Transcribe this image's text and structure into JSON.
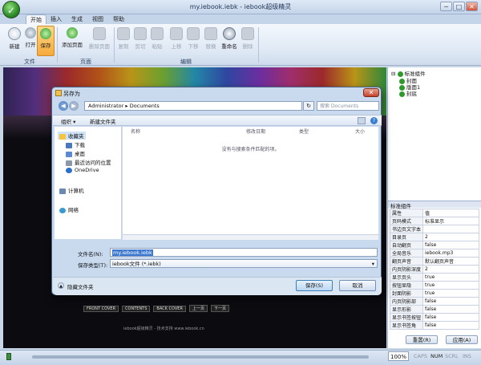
{
  "window": {
    "title": "my.iebook.iebk - iebook超级精灵",
    "logo_glyph": "✓",
    "min": "─",
    "max": "□",
    "close": "✕"
  },
  "tabs": [
    "开始",
    "插入",
    "生成",
    "视图",
    "帮助"
  ],
  "ribbon": {
    "buttons": [
      "新建",
      "打开",
      "保存",
      "添加页面",
      "删除页面",
      "复制",
      "剪切",
      "粘贴",
      "上移",
      "下移",
      "替换",
      "重命名",
      "删除"
    ],
    "groups": [
      "文件",
      "页面",
      "编辑"
    ]
  },
  "tree": {
    "root": "标准组件",
    "items": [
      "封面",
      "版面1",
      "封底"
    ]
  },
  "properties": {
    "title": "标准组件",
    "header": [
      "属性",
      "值"
    ],
    "rows": [
      [
        "页码模式",
        "标准显示"
      ],
      [
        "书边页文字本",
        ""
      ],
      [
        "目录页",
        "2"
      ],
      [
        "自动翻页",
        "false"
      ],
      [
        "全局音乐",
        "iebook.mp3"
      ],
      [
        "翻页声音",
        "默认翻页声音"
      ],
      [
        "内页阴影深度",
        "2"
      ],
      [
        "显示页头",
        "true"
      ],
      [
        "按钮显隐",
        "true"
      ],
      [
        "封面阴影",
        "true"
      ],
      [
        "内页阴影部",
        "false"
      ],
      [
        "显示形影",
        "false"
      ],
      [
        "显示书签按钮",
        "false"
      ],
      [
        "显示书签角",
        "false"
      ]
    ],
    "reset_label": "重置(R)",
    "apply_label": "应用(A)"
  },
  "status": {
    "zoom": "100%",
    "caps": "CAPS",
    "num": "NUM",
    "scrl": "SCRL",
    "ins": "INS"
  },
  "canvas": {
    "nav": [
      "FRONT COVER",
      "CONTENTS",
      "BACK COVER",
      "上一页",
      "下一页"
    ],
    "footer": "iebook超级精灵 - 技术支持 www.iebook.cn"
  },
  "dialog": {
    "title": "另存为",
    "path": "Administrator ▸ Documents",
    "search_placeholder": "搜索 Documents",
    "organize": "组织 ▾",
    "new_folder": "新建文件夹",
    "nav": {
      "favorites": "收藏夹",
      "items": [
        "下载",
        "桌面",
        "最近访问的位置",
        "OneDrive"
      ],
      "computer": "计算机",
      "network": "网络"
    },
    "columns": [
      "名称",
      "修改日期",
      "类型",
      "大小"
    ],
    "empty": "没有与搜索条件匹配的项。",
    "filename_label": "文件名(N):",
    "filename_value": "my.iebook.iebk",
    "filetype_label": "保存类型(T):",
    "filetype_value": "iebook文件 (*.iebk)",
    "hide_folders": "隐藏文件夹",
    "save": "保存(S)",
    "cancel": "取消"
  }
}
